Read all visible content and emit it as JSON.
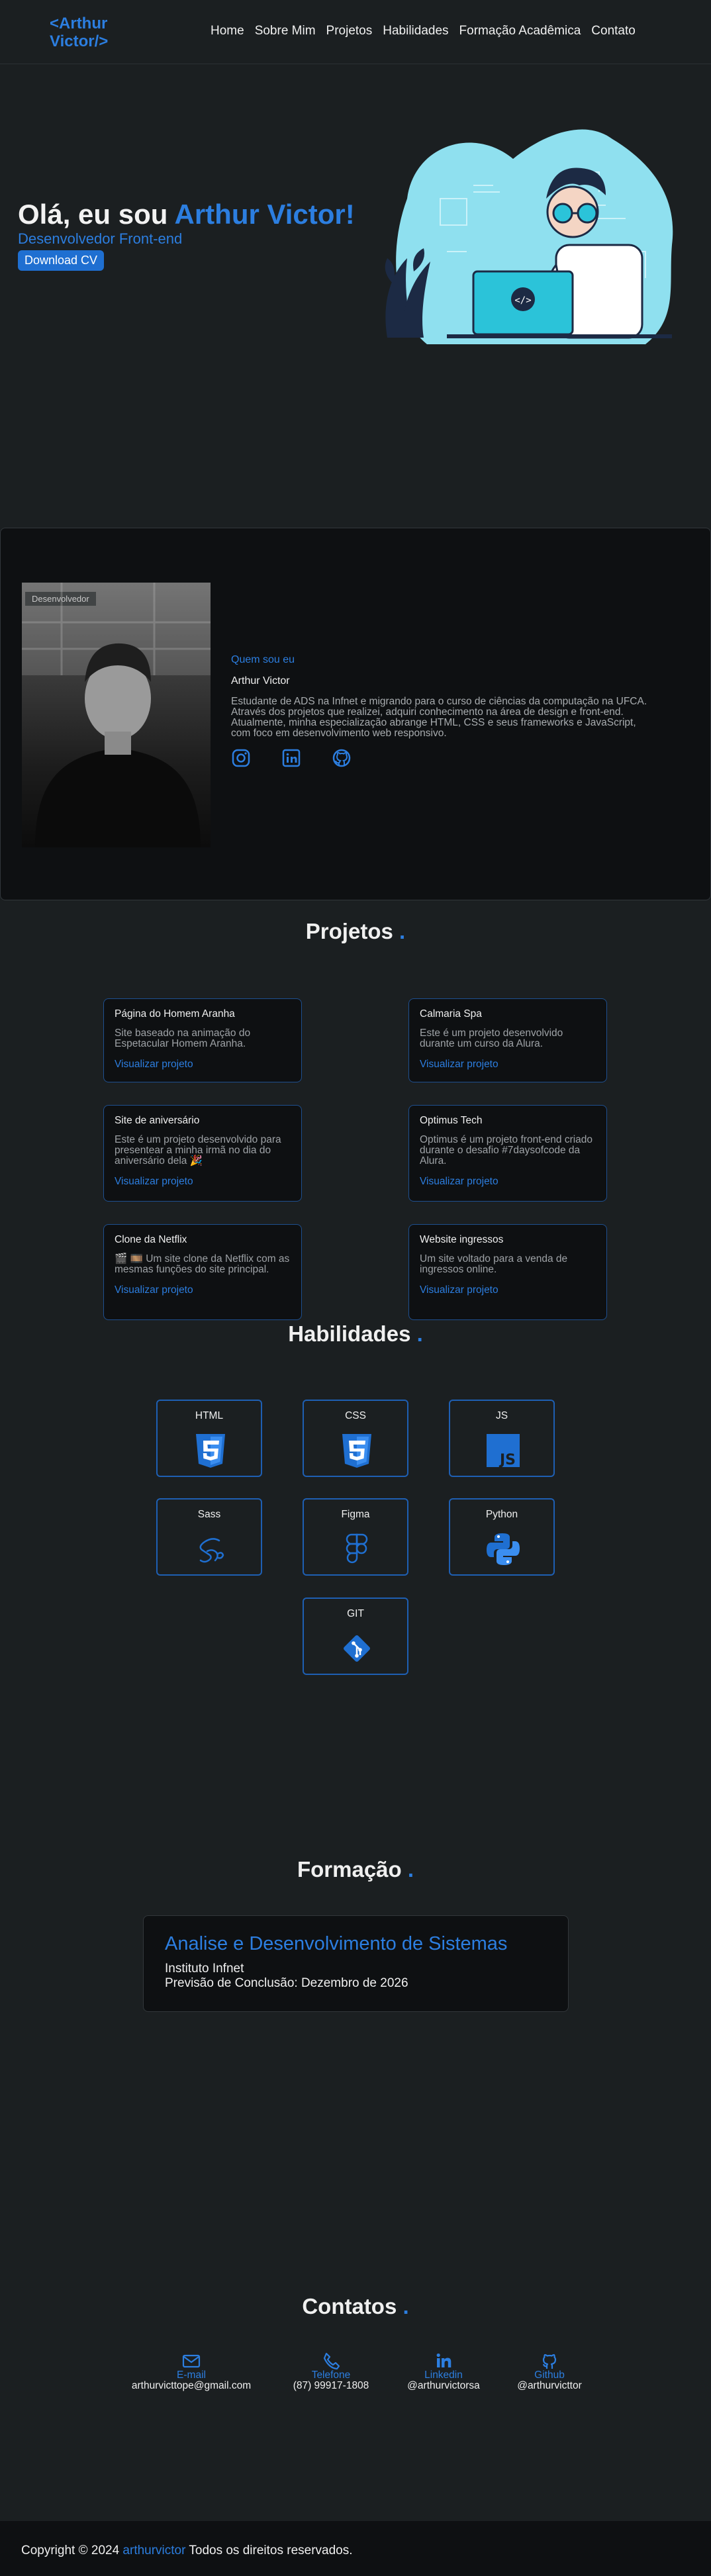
{
  "header": {
    "logo": "<Arthur Victor/>",
    "nav": [
      "Home",
      "Sobre Mim",
      "Projetos",
      "Habilidades",
      "Formação Acadêmica",
      "Contato"
    ]
  },
  "hero": {
    "greeting": "Olá, eu sou ",
    "name": "Arthur Victor!",
    "role": "Desenvolvedor Front-end",
    "cv_button": "Download CV",
    "illustration_icon": "developer-illustration"
  },
  "about": {
    "photo_badge": "Desenvolvedor",
    "kicker": "Quem sou eu",
    "name": "Arthur Victor",
    "description": "Estudante de ADS na Infnet e migrando para o curso de ciências da computação na UFCA. Através dos projetos que realizei, adquiri conhecimento na área de design e front-end. Atualmente, minha especialização abrange HTML, CSS e seus frameworks e JavaScript, com foco em desenvolvimento web responsivo.",
    "socials": [
      "instagram-icon",
      "linkedin-icon",
      "github-icon"
    ]
  },
  "projects": {
    "title": "Projetos",
    "dot": ".",
    "items": [
      {
        "title": "Página do Homem Aranha",
        "desc": "Site baseado na animação do Espetacular Homem Aranha.",
        "link": "Visualizar projeto"
      },
      {
        "title": "Calmaria Spa",
        "desc": "Este é um projeto desenvolvido durante um curso da Alura.",
        "link": "Visualizar projeto"
      },
      {
        "title": "Site de aniversário",
        "desc": "Este é um projeto desenvolvido para presentear a minha irmã no dia do aniversário dela 🎉",
        "link": "Visualizar projeto"
      },
      {
        "title": "Optimus Tech",
        "desc": "Optimus é um projeto front-end criado durante o desafio #7daysofcode da Alura.",
        "link": "Visualizar projeto"
      },
      {
        "title": "Clone da Netflix",
        "desc": "🎬 🎞️ Um site clone da Netflix com as mesmas funções do site principal.",
        "link": "Visualizar projeto"
      },
      {
        "title": "Website ingressos",
        "desc": "Um site voltado para a venda de ingressos online.",
        "link": "Visualizar projeto"
      }
    ]
  },
  "skills": {
    "title": "Habilidades",
    "dot": ".",
    "items": [
      {
        "name": "HTML",
        "icon": "html5-icon"
      },
      {
        "name": "CSS",
        "icon": "css3-icon"
      },
      {
        "name": "JS",
        "icon": "javascript-icon"
      },
      {
        "name": "Sass",
        "icon": "sass-icon"
      },
      {
        "name": "Figma",
        "icon": "figma-icon"
      },
      {
        "name": "Python",
        "icon": "python-icon"
      },
      {
        "name": "GIT",
        "icon": "git-icon"
      }
    ],
    "js_badge": "JS"
  },
  "education": {
    "title": "Formação",
    "dot": ".",
    "course": "Analise e Desenvolvimento de Sistemas",
    "institution": "Instituto Infnet",
    "date": "Previsão de Conclusão: Dezembro de 2026"
  },
  "contacts": {
    "title": "Contatos",
    "dot": ".",
    "items": [
      {
        "label": "E-mail",
        "value": "arthurvicttope@gmail.com",
        "icon": "mail-icon"
      },
      {
        "label": "Telefone",
        "value": "(87) 99917-1808",
        "icon": "phone-icon"
      },
      {
        "label": "Linkedin",
        "value": "@arthurvictorsa",
        "icon": "linkedin-icon"
      },
      {
        "label": "Github",
        "value": "@arthurvicttor",
        "icon": "github-icon"
      }
    ]
  },
  "footer": {
    "prefix": "Copyright © 2024 ",
    "handle": "arthurvictor",
    "suffix": " Todos os direitos reservados."
  },
  "colors": {
    "background": "#1b1f21",
    "accent": "#2c7ee0",
    "card_bg": "#0e1012",
    "card_border": "#1e4f8f"
  }
}
